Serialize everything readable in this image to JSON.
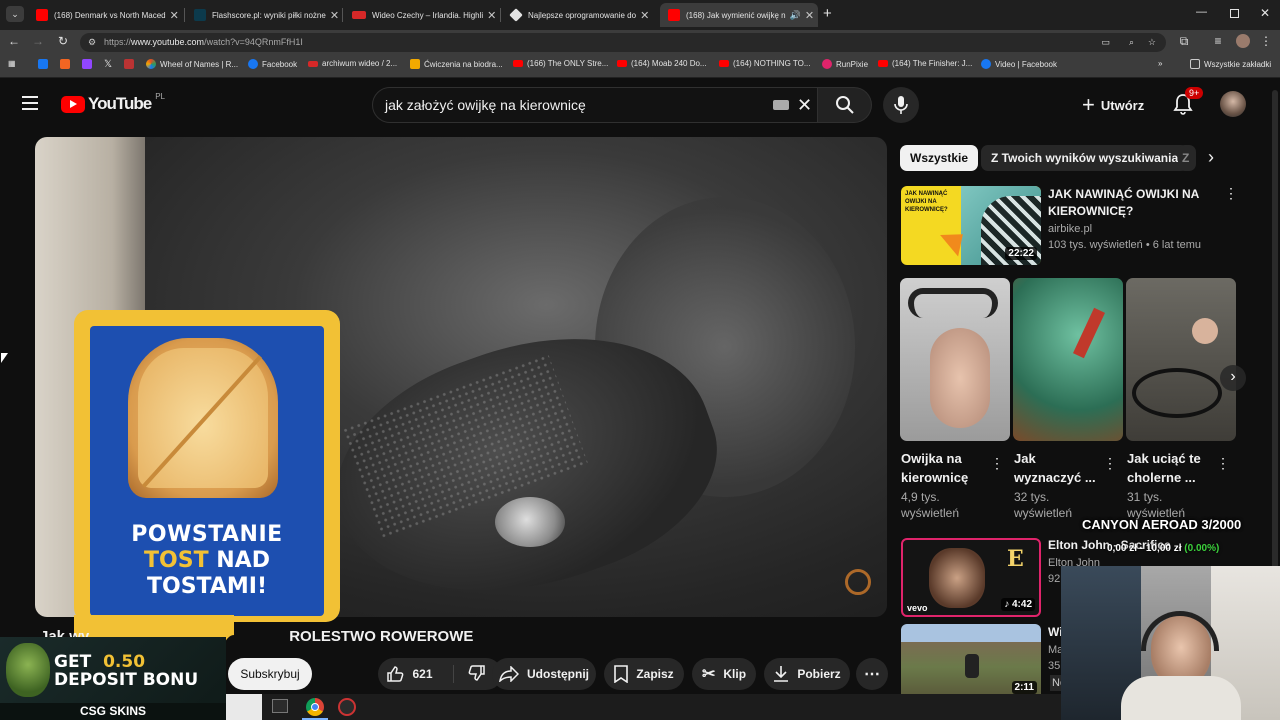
{
  "browser": {
    "tabs": [
      {
        "label": "(168) Denmark vs North Maced",
        "favicon": "youtube-icon",
        "color": "#ff0000"
      },
      {
        "label": "Flashscore.pl: wyniki piłki nożne",
        "favicon": "flashscore-icon",
        "color": "#0c3a4c"
      },
      {
        "label": "Wideo Czechy – Irlandia. Highli",
        "favicon": "live-icon",
        "color": "#d62828"
      },
      {
        "label": "Najlepsze oprogramowanie do",
        "favicon": "diamond-icon",
        "color": "#e3e3e3"
      },
      {
        "label": "(168) Jak wymienić owijkę n",
        "favicon": "youtube-icon",
        "color": "#ff0000"
      }
    ],
    "url_prefix": "https://",
    "url_host": "www.youtube.com",
    "url_path": "/watch?v=94QRnmFfH1I",
    "bookmarks": [
      {
        "label": "Wheel of Names | R...",
        "color": "#e34c26"
      },
      {
        "label": "Facebook",
        "color": "#1877f2"
      },
      {
        "label": "archiwum wideo / 2...",
        "color": "#d62828"
      },
      {
        "label": "Ćwiczenia na biodra...",
        "color": "#f2a900"
      },
      {
        "label": "(166) The ONLY Stre...",
        "color": "#ff0000"
      },
      {
        "label": "(164) Moab 240 Do...",
        "color": "#ff0000"
      },
      {
        "label": "(164) NOTHING TO...",
        "color": "#ff0000"
      },
      {
        "label": "RunPixie",
        "color": "#e0246b"
      },
      {
        "label": "(164) The Finisher: J...",
        "color": "#ff0000"
      },
      {
        "label": "Video | Facebook",
        "color": "#1877f2"
      }
    ],
    "all_bookmarks": "Wszystkie zakładki"
  },
  "youtube": {
    "logo_text": "YouTube",
    "region": "PL",
    "search_query": "jak założyć owijkę na kierownicę",
    "create_label": "Utwórz",
    "notification_count": "9+",
    "video_title_visible": "Jak wy",
    "video_title_tail": "ROLESTWO ROWEROWE",
    "subscribe_label": "Subskrybuj",
    "likes": "621",
    "share_label": "Udostępnij",
    "save_label": "Zapisz",
    "clip_label": "Klip",
    "download_label": "Pobierz"
  },
  "ad": {
    "line1": "POWSTANIE",
    "line2_highlight": "TOST",
    "line2_rest": " NAD",
    "line3": "TOSTAMI!"
  },
  "sidebar": {
    "chips": [
      "Wszystkie",
      "Z Twoich wyników wyszukiwania",
      "Z"
    ],
    "first_video": {
      "title": "JAK NAWINĄĆ OWIJKI NA KIEROWNICĘ?",
      "channel": "airbike.pl",
      "meta": "103 tys. wyświetleń • 6 lat temu",
      "duration": "22:22",
      "thumb_text": "JAK NAWINĄĆ OWIJKI NA KIEROWNICĘ?"
    },
    "shorts": [
      {
        "title": "Owijka na kierownicę",
        "views": "4,9 tys. wyświetleń"
      },
      {
        "title": "Jak wyznaczyć ...",
        "views": "32 tys. wyświetleń"
      },
      {
        "title": "Jak uciąć te cholerne ...",
        "views": "31 tys. wyświetleń"
      }
    ],
    "elton": {
      "title": "Elton John - Sacrifice",
      "channel": "Elton John",
      "duration": "4:42",
      "meta": "92"
    },
    "last": {
      "title": "Wi",
      "channel": "Ma",
      "meta": "35",
      "duration": "2:11",
      "extra": "No"
    }
  },
  "overlays": {
    "canyon_title": "CANYON AEROAD 3/2000",
    "canyon_prices": "0,00 zł",
    "canyon_price2": "10,00 zł",
    "canyon_pct": "(0.00%)",
    "csg_text1": "GET",
    "csg_amount": "0.50",
    "csg_text2": "DEPOSIT BONU",
    "csg_brand": "CSG SKINS"
  }
}
